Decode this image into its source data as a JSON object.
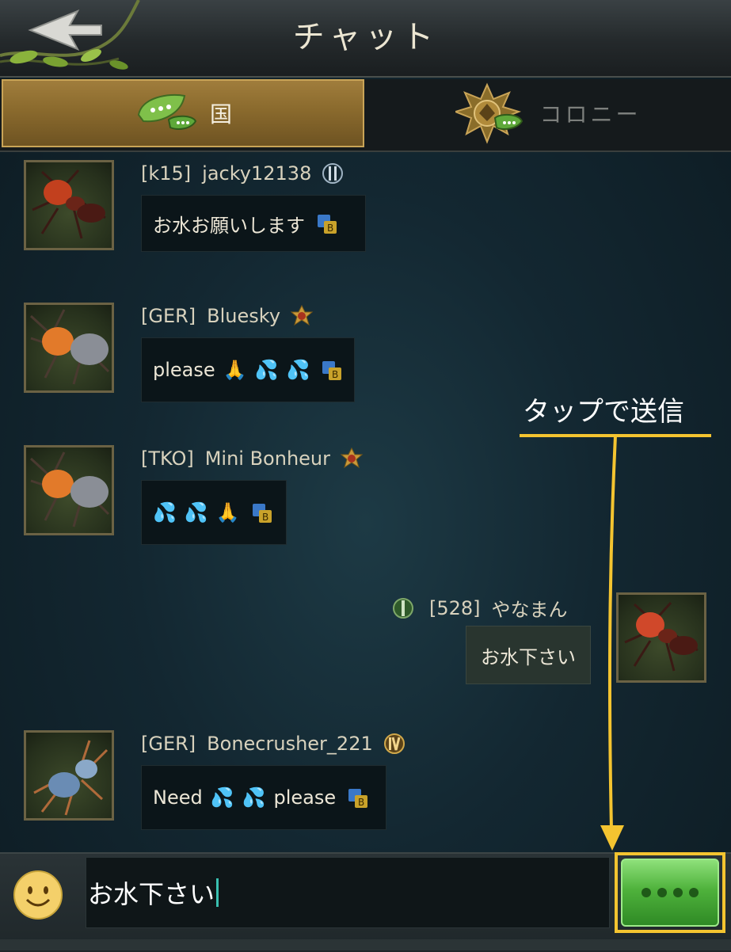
{
  "header": {
    "title": "チャット",
    "back_icon": "back-arrow-icon"
  },
  "tabs": [
    {
      "label": "国",
      "icon": "chat-leaf-icon",
      "active": true
    },
    {
      "label": "コロニー",
      "icon": "colony-emblem-icon",
      "active": false
    }
  ],
  "messages": [
    {
      "tag": "[k15]",
      "name": "jacky12138",
      "rank_icon": "rank-ii-icon",
      "text": "お水お願いします",
      "emojis": [],
      "avatar": "red-ant-avatar"
    },
    {
      "tag": "[GER]",
      "name": "Bluesky",
      "rank_icon": "rank-crest-icon",
      "text": "please",
      "emojis": [
        "🙏",
        "💦",
        "💦"
      ],
      "avatar": "orange-ant-avatar"
    },
    {
      "tag": "[TKO]",
      "name": "Mini Bonheur",
      "rank_icon": "rank-crest-icon",
      "text": "",
      "emojis": [
        "💦",
        "💦",
        "🙏"
      ],
      "avatar": "orange-ant-avatar"
    },
    {
      "tag": "[528]",
      "name": "やなまん",
      "rank_icon": "rank-i-icon",
      "text": "お水下さい",
      "emojis": [],
      "avatar": "red-ant-avatar",
      "self": true
    },
    {
      "tag": "[GER]",
      "name": "Bonecrusher_221",
      "rank_icon": "rank-iv-icon",
      "text_before": "Need",
      "emojis": [
        "💦",
        "💦"
      ],
      "text_after": "please",
      "avatar": "blue-ant-avatar"
    }
  ],
  "annotation": {
    "text": "タップで送信",
    "color": "#f4c430"
  },
  "input": {
    "value": "お水下さい",
    "emoji_icon": "smiley-icon",
    "send_icon": "send-button-icon"
  }
}
